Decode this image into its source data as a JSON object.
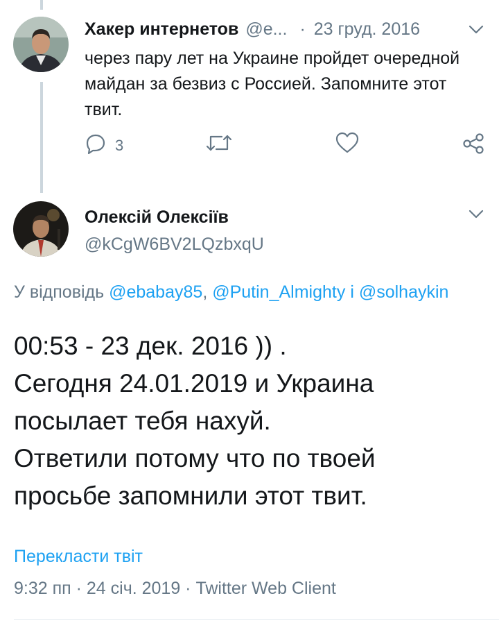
{
  "tweet1": {
    "author_name": "Хакер интернетов",
    "author_handle": "@e...",
    "separator": "·",
    "date": "23 груд. 2016",
    "text": "через пару лет на Украине пройдет очередной майдан за безвиз с Россией. Запомните этот твит.",
    "reply_count": "3",
    "icons": [
      "reply-icon",
      "retweet-icon",
      "like-icon",
      "share-icon",
      "chevron-down-icon"
    ]
  },
  "tweet2": {
    "author_name": "Олексій Олексіїв",
    "author_handle": "@kCgW6BV2LQzbxqU",
    "reply_prefix": "У відповідь",
    "mention_1": "@ebabay85",
    "comma": ",",
    "mention_2": "@Putin_Almighty",
    "conjunction": "і",
    "mention_3": "@solhaykin",
    "text_lines": [
      "00:53 - 23 дек. 2016 )) .",
      "Сегодня 24.01.2019 и Украина",
      "посылает тебя нахуй.",
      "Ответили потому что по твоей",
      "просьбе запомнили этот твит."
    ],
    "translate_label": "Перекласти твіт",
    "timestamp": "9:32 пп · 24 січ. 2019 · Twitter Web Client"
  },
  "colors": {
    "text_primary": "#14171a",
    "text_secondary": "#657786",
    "link": "#1da1f2",
    "thread_line": "#ccd6dd"
  }
}
